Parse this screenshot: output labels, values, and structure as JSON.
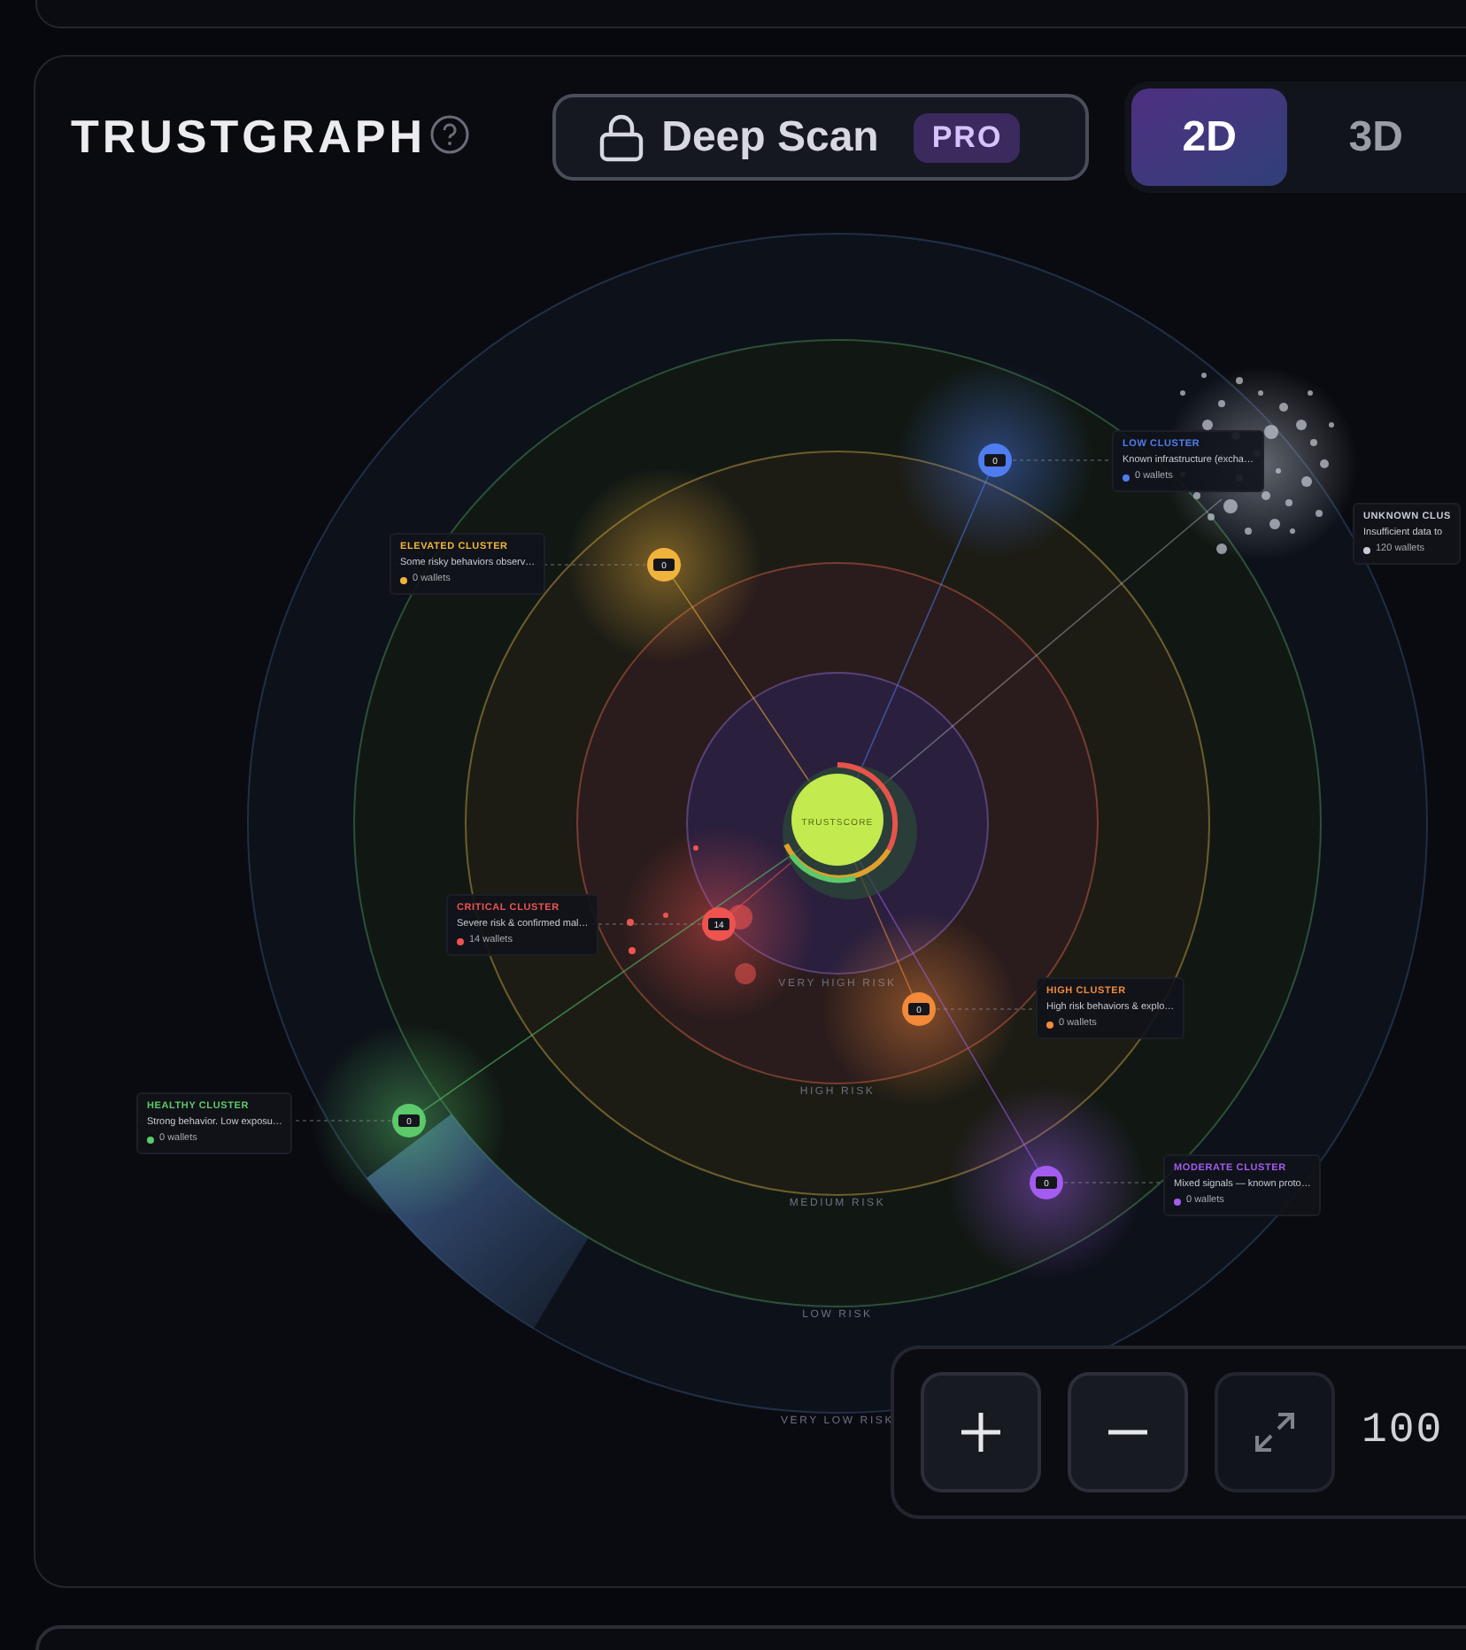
{
  "header": {
    "title": "TRUSTGRAPH",
    "deep_scan": {
      "label": "Deep Scan",
      "badge": "PRO"
    },
    "view_modes": [
      {
        "label": "2D",
        "selected": true
      },
      {
        "label": "3D",
        "selected": false
      }
    ]
  },
  "graph": {
    "center_label": "TRUSTSCORE",
    "rings": [
      "VERY HIGH RISK",
      "HIGH RISK",
      "MEDIUM RISK",
      "LOW RISK",
      "VERY LOW RISK"
    ],
    "clusters": [
      {
        "title": "LOW CLUSTER",
        "description": "Known infrastructure (excha…",
        "wallets": "0 wallets",
        "count": "0",
        "color": "#4f7df0"
      },
      {
        "title": "ELEVATED CLUSTER",
        "description": "Some risky behaviors observ…",
        "wallets": "0 wallets",
        "count": "0",
        "color": "#f0b43c"
      },
      {
        "title": "UNKNOWN CLUS",
        "description": "Insufficient data to",
        "wallets": "120 wallets",
        "color": "#c8ccd6"
      },
      {
        "title": "CRITICAL CLUSTER",
        "description": "Severe risk & confirmed mal…",
        "wallets": "14 wallets",
        "count": "14",
        "color": "#ef5350"
      },
      {
        "title": "HIGH CLUSTER",
        "description": "High risk behaviors & explo…",
        "wallets": "0 wallets",
        "count": "0",
        "color": "#f28a3a"
      },
      {
        "title": "HEALTHY CLUSTER",
        "description": "Strong behavior. Low exposu…",
        "wallets": "0 wallets",
        "count": "0",
        "color": "#5cc96a"
      },
      {
        "title": "MODERATE CLUSTER",
        "description": "Mixed signals — known proto…",
        "wallets": "0 wallets",
        "count": "0",
        "color": "#a35cf0"
      }
    ]
  },
  "zoom": {
    "level": "100"
  }
}
